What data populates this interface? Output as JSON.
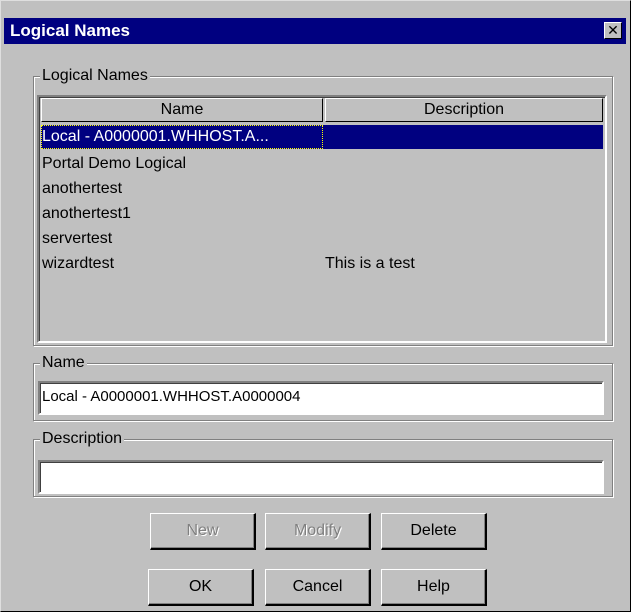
{
  "window": {
    "title": "Logical Names",
    "close_glyph": "✕"
  },
  "logical_names_group": {
    "label": "Logical Names",
    "columns": [
      "Name",
      "Description"
    ],
    "rows": [
      {
        "name": "Local - A0000001.WHHOST.A...",
        "description": "",
        "selected": true
      },
      {
        "name": "Portal Demo Logical",
        "description": ""
      },
      {
        "name": "anothertest",
        "description": ""
      },
      {
        "name": "anothertest1",
        "description": ""
      },
      {
        "name": "servertest",
        "description": ""
      },
      {
        "name": "wizardtest",
        "description": "This is a test"
      }
    ]
  },
  "name_group": {
    "label": "Name",
    "value": "Local - A0000001.WHHOST.A0000004"
  },
  "description_group": {
    "label": "Description",
    "value": ""
  },
  "buttons": {
    "new": "New",
    "modify": "Modify",
    "delete": "Delete",
    "ok": "OK",
    "cancel": "Cancel",
    "help": "Help"
  },
  "colors": {
    "titlebar": "#000080",
    "face": "#c0c0c0",
    "selection": "#000080"
  }
}
